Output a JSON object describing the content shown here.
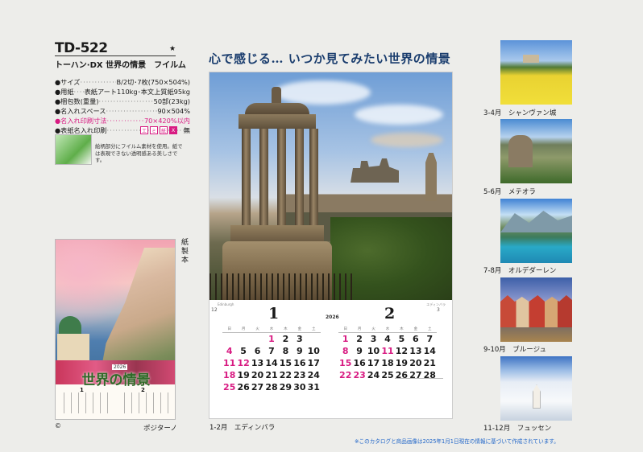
{
  "product": {
    "code": "TD-522",
    "star": "★",
    "name": "トーハン·DX 世界の情景　フイルム",
    "specs": [
      {
        "label": "サイズ",
        "value": "B/2切･7枚(750×504%)",
        "highlight": false
      },
      {
        "label": "用紙",
        "value": "表紙アート110kg･本文上質紙95kg",
        "highlight": false
      },
      {
        "label": "梱包数(重量)",
        "value": "50部(23kg)",
        "highlight": false
      },
      {
        "label": "名入れスペース",
        "value": "90×504%",
        "highlight": false
      },
      {
        "label": "名入れ印刷寸法",
        "value": "70×420%以内",
        "highlight": true
      },
      {
        "label": "表紙名入れ印刷",
        "value": "無",
        "highlight": false
      }
    ],
    "bullet": "●",
    "badges": [
      "エ",
      "ミ",
      "紙",
      "X"
    ],
    "film_note": "絵柄部分にフイルム素材を使用。紙では表現できない透明感ある美しさです。"
  },
  "small_calendar": {
    "title": "世界の情景",
    "year": "2026",
    "months": [
      "1",
      "2"
    ],
    "kind": "紙製本",
    "mark": "©",
    "caption": "ポジターノ"
  },
  "headline": "心で感じる…  いつか見てみたい世界の情景",
  "main_calendar": {
    "caption": "1-2月　エディンバラ",
    "year": "2026",
    "strip_left": "Edinburgh",
    "strip_right": "エディンバラ",
    "weekdays": [
      "日",
      "月",
      "火",
      "水",
      "木",
      "金",
      "土"
    ],
    "months": [
      {
        "number": "1",
        "prev": "12",
        "next": "",
        "days": [
          "",
          "",
          "",
          "1",
          "2",
          "3",
          "",
          "4",
          "5",
          "6",
          "7",
          "8",
          "9",
          "10",
          "11",
          "12",
          "13",
          "14",
          "15",
          "16",
          "17",
          "18",
          "19",
          "20",
          "21",
          "22",
          "23",
          "24",
          "25",
          "26",
          "27",
          "28",
          "29",
          "30",
          "31"
        ],
        "red": [
          "1",
          "4",
          "11",
          "12",
          "18",
          "25"
        ]
      },
      {
        "number": "2",
        "prev": "",
        "next": "3",
        "days": [
          "1",
          "2",
          "3",
          "4",
          "5",
          "6",
          "7",
          "8",
          "9",
          "10",
          "11",
          "12",
          "13",
          "14",
          "15",
          "16",
          "17",
          "18",
          "19",
          "20",
          "21",
          "22",
          "23",
          "24",
          "25",
          "26",
          "27",
          "28"
        ],
        "red": [
          "1",
          "8",
          "11",
          "15",
          "22",
          "23"
        ]
      }
    ]
  },
  "thumbnails": [
    {
      "caption": "3-4月　シャンヴァン城"
    },
    {
      "caption": "5-6月　メテオラ"
    },
    {
      "caption": "7-8月　オルデダーレン"
    },
    {
      "caption": "9-10月　ブルージュ"
    },
    {
      "caption": "11-12月　フュッセン"
    }
  ],
  "footnote": "※このカタログと商品画像は2025年1月1日現在の情報に基づいて作成されています。"
}
